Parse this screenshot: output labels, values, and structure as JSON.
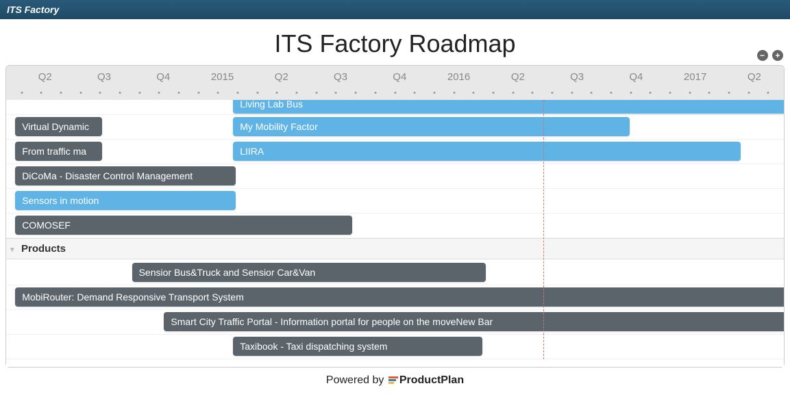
{
  "header": {
    "brand": "ITS Factory"
  },
  "title": "ITS Factory Roadmap",
  "zoom": {
    "minus": "−",
    "plus": "+"
  },
  "timeline": {
    "labels": [
      {
        "text": "Q2",
        "pct": 5.0
      },
      {
        "text": "Q3",
        "pct": 12.6
      },
      {
        "text": "Q4",
        "pct": 20.2
      },
      {
        "text": "2015",
        "pct": 27.8
      },
      {
        "text": "Q2",
        "pct": 35.4
      },
      {
        "text": "Q3",
        "pct": 43.0
      },
      {
        "text": "Q4",
        "pct": 50.6
      },
      {
        "text": "2016",
        "pct": 58.2
      },
      {
        "text": "Q2",
        "pct": 65.8
      },
      {
        "text": "Q3",
        "pct": 73.4
      },
      {
        "text": "Q4",
        "pct": 81.0
      },
      {
        "text": "2017",
        "pct": 88.6
      },
      {
        "text": "Q2",
        "pct": 96.2
      }
    ],
    "tick_count": 39,
    "now_pct": 65.3
  },
  "lanes": {
    "top_group": [
      {
        "label": "Living Lab Bus",
        "color": "blue",
        "left_pct": 27.6,
        "right_pct": 100
      },
      {
        "label": "Virtual Dynamic",
        "color": "gray",
        "left_pct": 1.1,
        "width_pct": 10.6
      },
      {
        "label": "My Mobility Factor",
        "color": "blue",
        "left_pct": 27.6,
        "width_pct": 48.2,
        "same_row_as_prev": true
      },
      {
        "label": "From traffic ma",
        "color": "gray",
        "left_pct": 1.1,
        "width_pct": 10.6
      },
      {
        "label": "LIIRA",
        "color": "blue",
        "left_pct": 27.6,
        "width_pct": 61.7,
        "same_row_as_prev": true
      },
      {
        "label": "DiCoMa - Disaster Control Management",
        "color": "gray",
        "left_pct": 1.1,
        "width_pct": 26.8
      },
      {
        "label": "Sensors in motion",
        "color": "blue",
        "left_pct": 1.1,
        "width_pct": 26.8
      },
      {
        "label": "COMOSEF",
        "color": "gray",
        "left_pct": 1.1,
        "width_pct": 41.0
      }
    ],
    "products_header": "Products",
    "products": [
      {
        "label": "Sensior Bus&Truck and Sensior Car&Van",
        "color": "gray",
        "left_pct": 15.3,
        "width_pct": 43.0
      },
      {
        "label": "MobiRouter: Demand Responsive Transport System",
        "color": "gray",
        "left_pct": 1.1,
        "right_pct": 100
      },
      {
        "label": "Smart City Traffic Portal - Information portal for people on the moveNew Bar",
        "color": "gray",
        "left_pct": 19.2,
        "right_pct": 100
      },
      {
        "label": "Taxibook - Taxi dispatching system",
        "color": "gray",
        "left_pct": 27.6,
        "width_pct": 30.3
      }
    ]
  },
  "footer": {
    "powered_by": "Powered by",
    "brand": "ProductPlan"
  }
}
